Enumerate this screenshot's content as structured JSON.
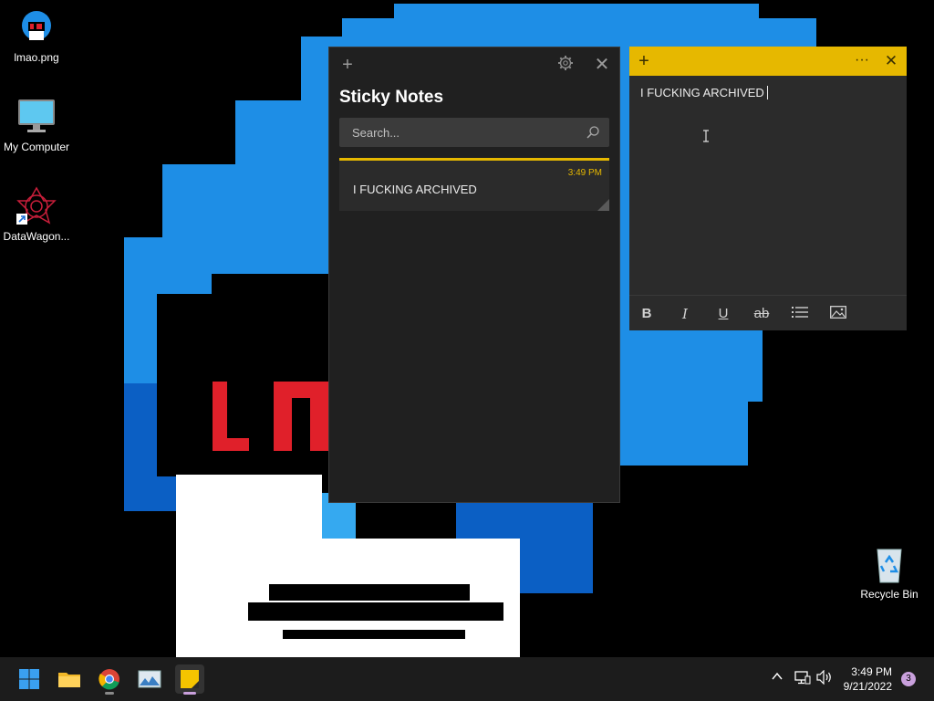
{
  "desktop": {
    "icons": [
      {
        "label": "lmao.png"
      },
      {
        "label": "My Computer"
      },
      {
        "label": "DataWagon..."
      },
      {
        "label": "Recycle Bin"
      }
    ]
  },
  "sticky_list": {
    "title": "Sticky Notes",
    "search_placeholder": "Search...",
    "notes": [
      {
        "time": "3:49 PM",
        "text": "I FUCKING ARCHIVED"
      }
    ]
  },
  "note_window": {
    "content": "I FUCKING ARCHIVED",
    "header_color": "#e6b800",
    "toolbar": [
      "B",
      "I",
      "U",
      "ab",
      "list",
      "image"
    ]
  },
  "taskbar": {
    "apps": [
      "start-icon",
      "file-explorer-icon",
      "chrome-icon",
      "photos-icon",
      "sticky-notes-icon"
    ],
    "clock_time": "3:49 PM",
    "clock_date": "9/21/2022",
    "notification_count": "3"
  },
  "colors": {
    "accent_yellow": "#e6b800",
    "wallpaper_blue": "#1e8ee6",
    "taskbar_bg": "#1c1c1c"
  }
}
